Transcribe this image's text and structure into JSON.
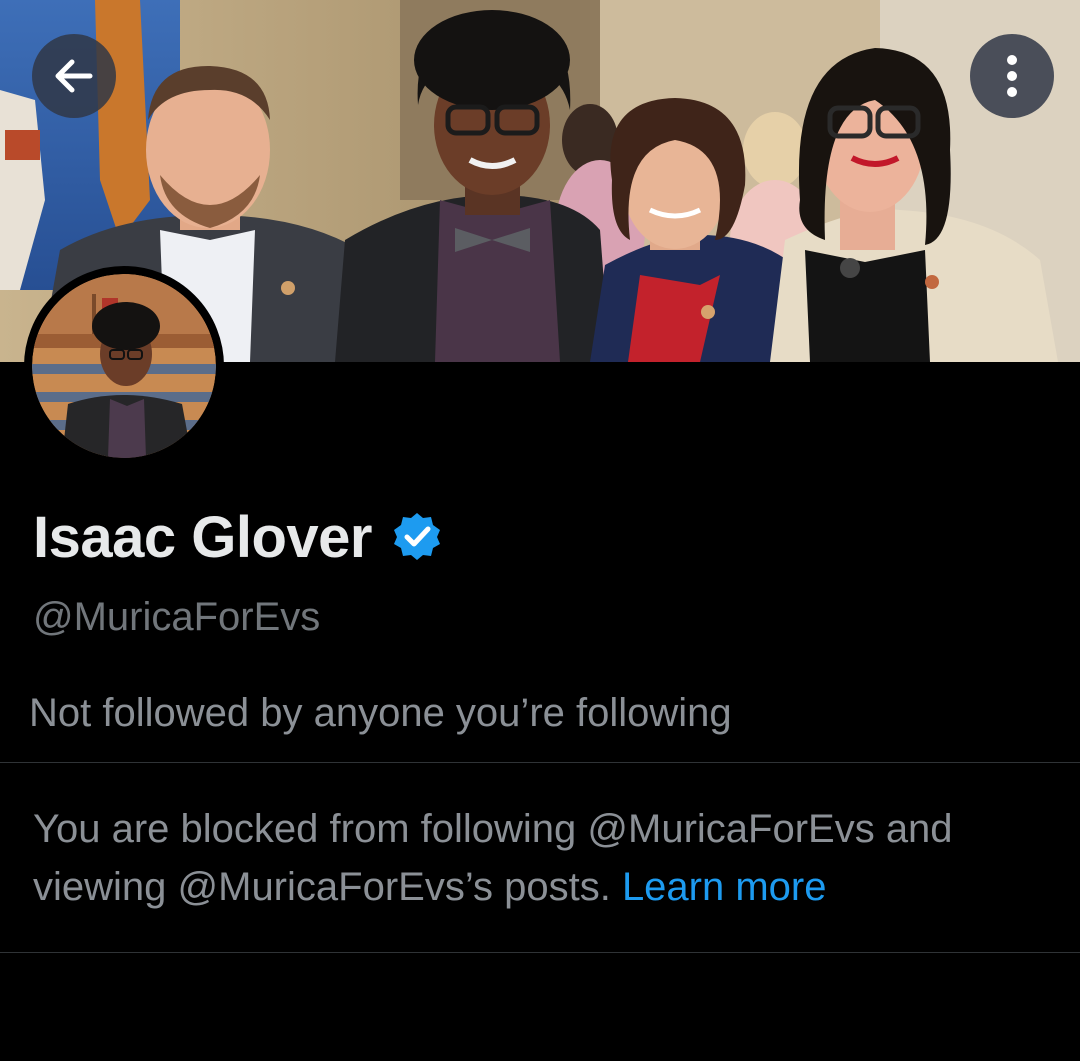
{
  "header": {
    "back_icon": "arrow-left-icon",
    "more_icon": "more-vertical-icon"
  },
  "profile": {
    "display_name": "Isaac Glover",
    "verified_icon": "verified-badge-icon",
    "verified_color": "#1d9bf0",
    "handle": "@MuricaForEvs",
    "followed_by_text": "Not followed by anyone you’re following"
  },
  "blocked": {
    "text_part1": "You are blocked from following @MuricaForEvs and viewing @MuricaForEvs’s posts.",
    "learn_more_label": "Learn more",
    "link_color": "#1d9bf0"
  },
  "colors": {
    "background": "#000000",
    "primary_text": "#e7e9ea",
    "secondary_text": "#71767b",
    "divider": "#2f3336"
  }
}
